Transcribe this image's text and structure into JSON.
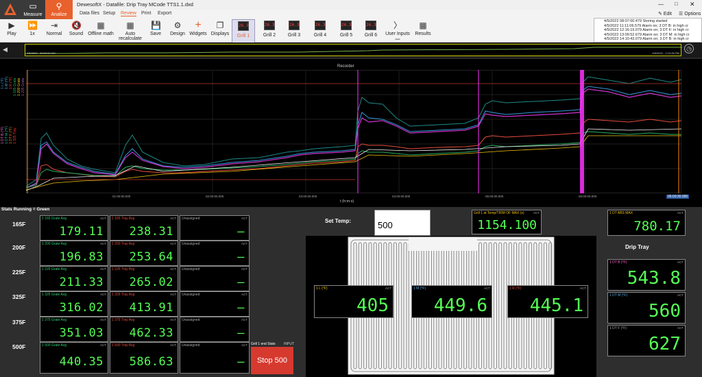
{
  "title": "DewesoftX - Datafile: Drip Tray MCode TTS1.1.dxd",
  "main_tabs": [
    "Measure",
    "Analize"
  ],
  "menu": [
    "Data files",
    "Setup",
    "Review",
    "Print",
    "Export"
  ],
  "top_right": {
    "edit": "Edit",
    "options": "Options"
  },
  "toolbar": {
    "play": "Play",
    "speed": "1x",
    "normal": "Normal",
    "sound": "Sound",
    "offline_math": "Offline math",
    "auto_recalculate": "Auto recalculate",
    "save": "Save",
    "design": "Design",
    "widgets": "Widgets",
    "displays": "Displays",
    "user_inputs": "User Inputs",
    "results": "Results"
  },
  "grills": [
    "Grill 1",
    "Grill 2",
    "Grill 3",
    "Grill 4",
    "Grill 5",
    "Grill 6"
  ],
  "grill_icon_text": "26.3",
  "events": [
    "4/5/2022 08:07:00.479 Storing started",
    "4/5/2022 11:11:06.579 Alarm on; 3 DT B: in high cr",
    "4/5/2022 12:16:19.079 Alarm on; 3 DT F: in high cr",
    "4/5/2022 13:09:52.679 Alarm on; 3 DT M: in high cr",
    "4/5/2022 14:10:43.079 Alarm on; 3 DT B: in high cr"
  ],
  "overview": {
    "start": "4/5/2022 - 08:00:00 AM",
    "end": "4/5/2022 - 2:10:30 PM"
  },
  "recorder": {
    "title": "Recorder",
    "xlabel": "t (h:m:s)",
    "ticks": [
      "01:00:00.000",
      "02:00:00.000",
      "03:00:00.000",
      "04:00:00.000",
      "05:00:00.000",
      "06:00:00.000"
    ],
    "end_time": "06:03:30.000",
    "axis_labels": [
      "1 L (°F)",
      "1 M (°F)",
      "1 R (°F)",
      "1 165 Grate",
      "1 200 Grate",
      "1 225 Grate",
      "1 DT B (°F)",
      "1 DT M (°F)",
      "1 DT F (°F)",
      "1 325 Tray"
    ]
  },
  "stats_title": "Stats Running = Green",
  "rows": [
    {
      "label": "165F",
      "grate_title": "1 165 Grate Avg",
      "grate": "179.11",
      "tray_title": "1 165 Tray Avg",
      "tray": "238.31"
    },
    {
      "label": "200F",
      "grate_title": "1 200 Grate Avg",
      "grate": "196.83",
      "tray_title": "1 200 Tray Avg",
      "tray": "253.64"
    },
    {
      "label": "225F",
      "grate_title": "1 225 Grate Avg",
      "grate": "211.33",
      "tray_title": "1 225 Tray Avg",
      "tray": "265.02"
    },
    {
      "label": "325F",
      "grate_title": "1 325 Grate Avg",
      "grate": "316.02",
      "tray_title": "1 325 Tray Avg",
      "tray": "413.91"
    },
    {
      "label": "375F",
      "grate_title": "1 375 Grate Avg",
      "grate": "351.03",
      "tray_title": "1 375 Tray Avg",
      "tray": "462.33"
    },
    {
      "label": "500F",
      "grate_title": "1 500 Grate Avg",
      "grate": "440.35",
      "tray_title": "1 500 Tray Avg",
      "tray": "586.63"
    }
  ],
  "unassigned": "Unassigned",
  "dash": "—",
  "act": "ACT",
  "grill_stats": {
    "label": "Grill 1 end Stats",
    "input": "INPUT",
    "button": "Stop 500"
  },
  "set_temp": {
    "label": "Set Temp:",
    "value": "500"
  },
  "time_at_temp": {
    "title": "Grill 1 at Temp/TRIM OF MAX (s)",
    "value": "1154.100"
  },
  "dt_abs_max": {
    "title": "1 DT ABS MAX",
    "value": "780.17"
  },
  "grate_readings": [
    {
      "title": "1 L (°F)",
      "value": "405"
    },
    {
      "title": "1 M (°F)",
      "value": "449.6"
    },
    {
      "title": "1 R (°F)",
      "value": "445.1"
    }
  ],
  "drip_tray": {
    "label": "Drip Tray",
    "readings": [
      {
        "title": "1 DT B (°F)",
        "value": "543.8"
      },
      {
        "title": "1 DT M (°F)",
        "value": "560"
      },
      {
        "title": "1 DT F (°F)",
        "value": "627"
      }
    ]
  },
  "colors": {
    "accent": "#e8612c",
    "value_green": "#55ff55",
    "stop_button": "#d63a2f"
  }
}
